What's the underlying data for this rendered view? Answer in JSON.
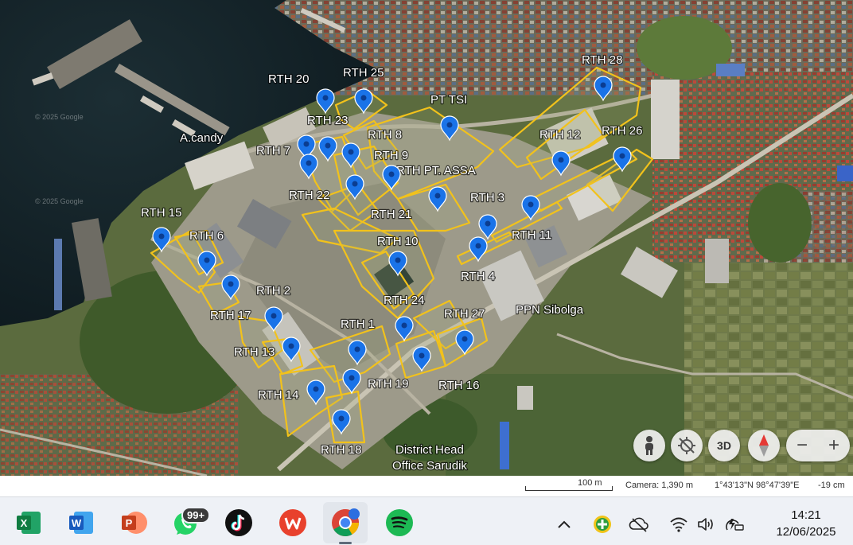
{
  "map": {
    "place_labels": [
      "RTH 20",
      "RTH 25",
      "PT TSI",
      "RTH 28",
      "RTH 23",
      "RTH 8",
      "RTH 12",
      "RTH 26",
      "A.candy",
      "RTH 7",
      "RTH 9",
      "RTH PT. ASSA",
      "RTH 22",
      "RTH 3",
      "RTH 15",
      "RTH 21",
      "RTH 11",
      "RTH 6",
      "RTH 10",
      "RTH 4",
      "RTH 2",
      "RTH 24",
      "PPN Sibolga",
      "RTH 17",
      "RTH 27",
      "RTH 1",
      "RTH 13",
      "RTH 19",
      "RTH 16",
      "RTH 14",
      "RTH 18",
      "District Head",
      "Office Sarudik"
    ],
    "watermark": "© 2025 Google",
    "marker_color": "#1a73e8",
    "polygon_color": "#f2c21b"
  },
  "controls": {
    "three_d_label": "3D",
    "zoom_out": "−",
    "zoom_in": "+"
  },
  "status": {
    "scale": "100 m",
    "camera": "Camera: 1,390 m",
    "coords": "1°43'13\"N 98°47'39\"E",
    "elevation": "-19 cm"
  },
  "taskbar": {
    "apps": [
      {
        "name": "Excel",
        "letter": "X",
        "color": "#1d6f42"
      },
      {
        "name": "Word",
        "letter": "W",
        "color": "#2b579a"
      },
      {
        "name": "PowerPoint",
        "letter": "P",
        "color": "#d24726"
      },
      {
        "name": "WhatsApp",
        "letter": "",
        "color": "#25d366"
      },
      {
        "name": "TikTok",
        "letter": "",
        "color": "#111111"
      },
      {
        "name": "WPS Office",
        "letter": "W",
        "color": "#e8412d"
      },
      {
        "name": "Chrome",
        "letter": "",
        "color": "#4285f4"
      },
      {
        "name": "Spotify",
        "letter": "",
        "color": "#1db954"
      }
    ],
    "whatsapp_badge": "99+",
    "time": "14:21",
    "date": "12/06/2025"
  }
}
